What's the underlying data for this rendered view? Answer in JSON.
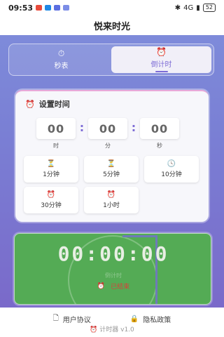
{
  "status_bar": {
    "time": "09:53",
    "notif_colors": [
      "#e94b3c",
      "#1e88e5",
      "#5b6ee1",
      "#7c8de6"
    ],
    "signal_text": "4G",
    "battery": "52"
  },
  "header": {
    "title": "悦来时光"
  },
  "mode_tabs": [
    {
      "label": "秒表",
      "icon": "⏱",
      "active": false
    },
    {
      "label": "倒计时",
      "icon": "⏰",
      "active": true
    }
  ],
  "setup": {
    "title": "设置时间",
    "title_icon": "⏰",
    "hours": "00",
    "minutes": "00",
    "seconds": "00",
    "hours_label": "时",
    "minutes_label": "分",
    "seconds_label": "秒",
    "colon": ":",
    "presets": [
      {
        "label": "1分钟",
        "icon": "⏳"
      },
      {
        "label": "5分钟",
        "icon": "⏳"
      },
      {
        "label": "10分钟",
        "icon": "🕓"
      },
      {
        "label": "30分钟",
        "icon": "⏰"
      },
      {
        "label": "1小时",
        "icon": "⏰"
      }
    ]
  },
  "timer": {
    "display": "00:00:00",
    "sub_label": "倒计时",
    "status_icon": "⏰",
    "status_text": "已结束",
    "bg_color": "#54ab55"
  },
  "footer": {
    "user_agreement": "用户协议",
    "privacy_policy": "隐私政策",
    "version": "计时器 v1.0",
    "version_icon": "⏰"
  }
}
